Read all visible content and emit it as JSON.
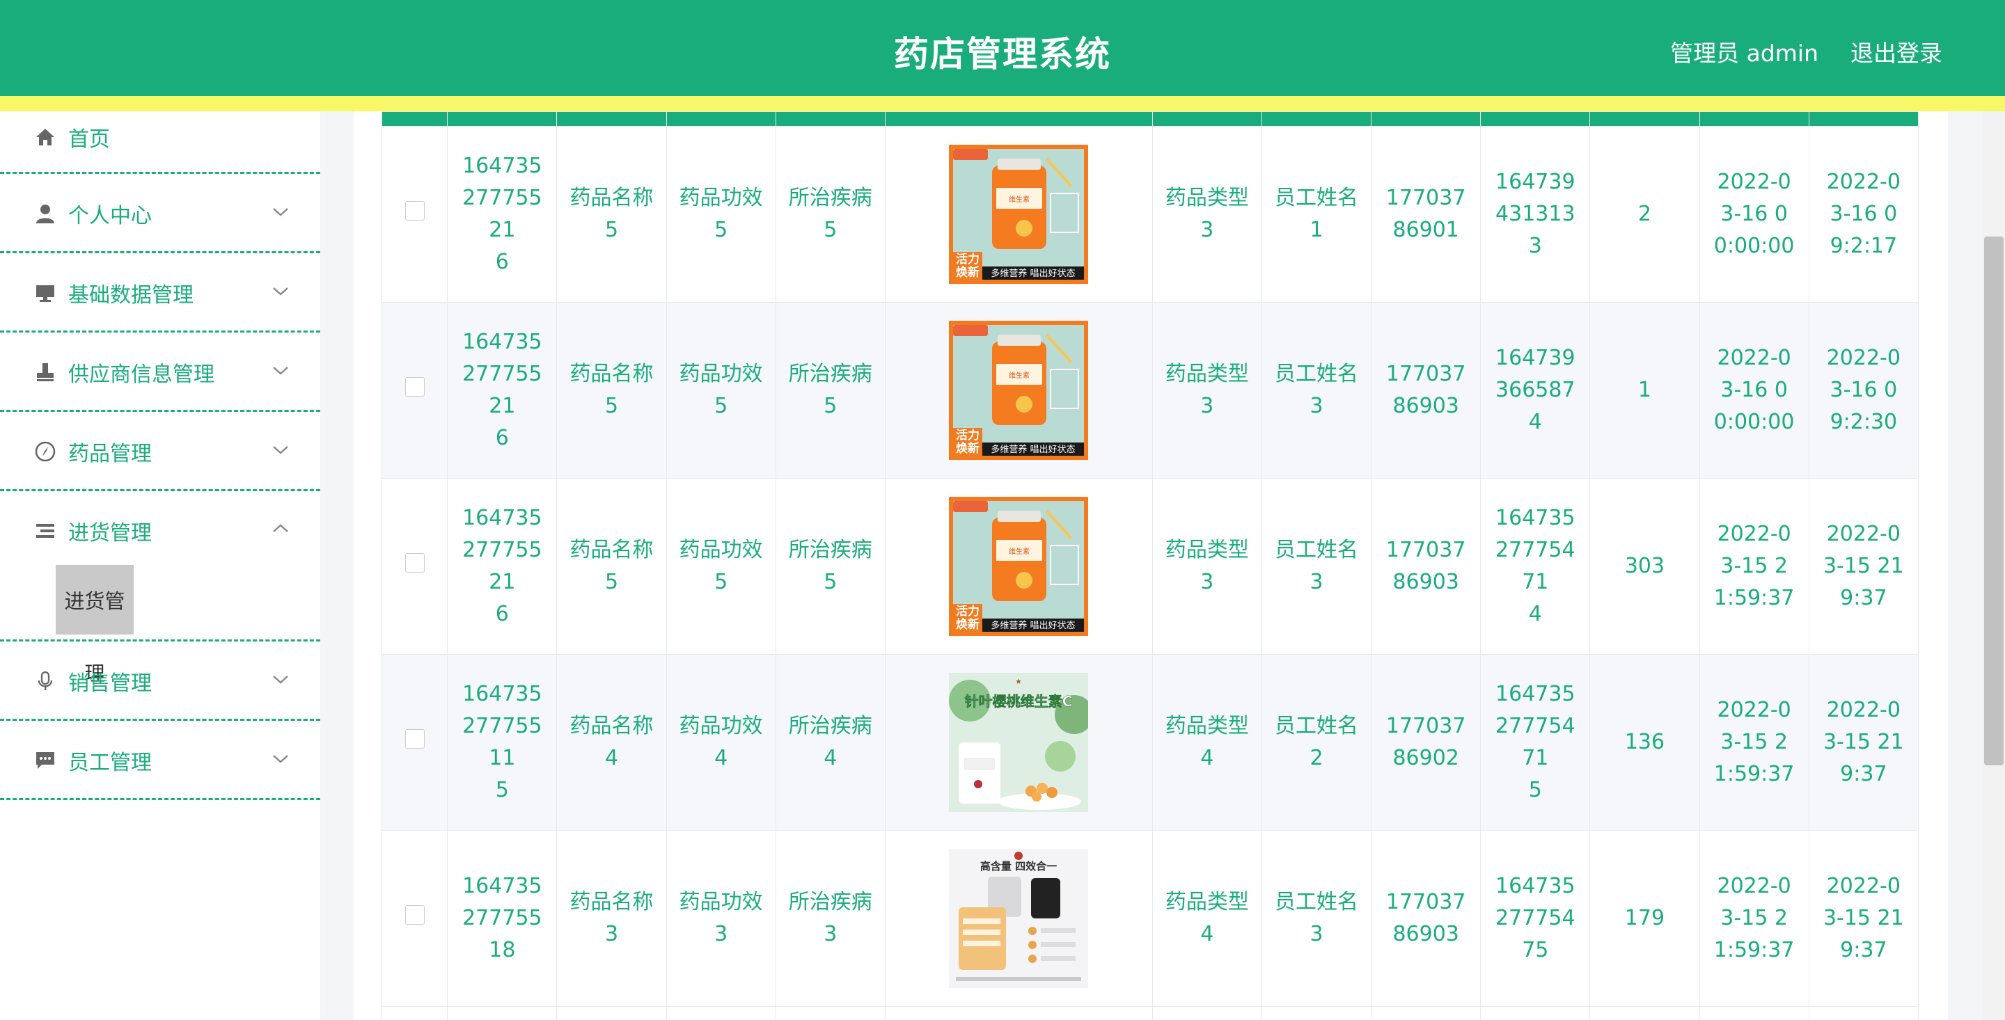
{
  "header": {
    "title": "药店管理系统",
    "user": "管理员 admin",
    "logout": "退出登录",
    "color": "#1aad7c",
    "stripe_color": "#f6f868"
  },
  "sidebar": {
    "items": [
      {
        "label": "首页",
        "icon": "home-icon"
      },
      {
        "label": "个人中心",
        "icon": "user-icon"
      },
      {
        "label": "基础数据管理",
        "icon": "monitor-icon"
      },
      {
        "label": "供应商信息管理",
        "icon": "stamp-icon"
      },
      {
        "label": "药品管理",
        "icon": "compass-icon"
      },
      {
        "label": "进货管理",
        "icon": "list-icon",
        "submenu": [
          "进货管理"
        ]
      },
      {
        "label": "销售管理",
        "icon": "microphone-icon"
      },
      {
        "label": "员工管理",
        "icon": "chat-icon"
      }
    ]
  },
  "table": {
    "rows": [
      {
        "id": "16473527775521\n6",
        "name": "药品名称\n5",
        "effect": "药品功效\n5",
        "disease": "所治疾病\n5",
        "image": "orange-supplement",
        "type": "药品类型\n3",
        "staff": "员工姓名\n1",
        "phone": "17703786901",
        "order": "1647394313133",
        "qty": "2",
        "date": "2022-03-16 00:00:00",
        "time": "2022-03-16 09:2:17"
      },
      {
        "id": "16473527775521\n6",
        "name": "药品名称\n5",
        "effect": "药品功效\n5",
        "disease": "所治疾病\n5",
        "image": "orange-supplement",
        "type": "药品类型\n3",
        "staff": "员工姓名\n3",
        "phone": "17703786903",
        "order": "1647393665874",
        "qty": "1",
        "date": "2022-03-16 00:00:00",
        "time": "2022-03-16 09:2:30"
      },
      {
        "id": "16473527775521\n6",
        "name": "药品名称\n5",
        "effect": "药品功效\n5",
        "disease": "所治疾病\n5",
        "image": "orange-supplement",
        "type": "药品类型\n3",
        "staff": "员工姓名\n3",
        "phone": "17703786903",
        "order": "16473527775471\n4",
        "qty": "303",
        "date": "2022-03-15 21:59:37",
        "time": "2022-03-15 219:37"
      },
      {
        "id": "16473527775511\n5",
        "name": "药品名称\n4",
        "effect": "药品功效\n4",
        "disease": "所治疾病\n4",
        "image": "vitamin-c",
        "type": "药品类型\n4",
        "staff": "员工姓名\n2",
        "phone": "17703786902",
        "order": "16473527775471\n5",
        "qty": "136",
        "date": "2022-03-15 21:59:37",
        "time": "2022-03-15 219:37"
      },
      {
        "id": "16473527775518",
        "name": "药品名称\n3",
        "effect": "药品功效\n3",
        "disease": "所治疾病\n3",
        "image": "calcium-poster",
        "type": "药品类型\n4",
        "staff": "员工姓名\n3",
        "phone": "17703786903",
        "order": "16473527775475",
        "qty": "179",
        "date": "2022-03-15 21:59:37",
        "time": "2022-03-15 219:37"
      }
    ]
  },
  "product_images": {
    "orange-supplement": {
      "badge": "活力\n焕新",
      "caption": "多维营养 唱出好状态",
      "jar_label": "维生素"
    },
    "vitamin-c": {
      "headline": "针叶樱桃维生素C"
    },
    "calcium-poster": {
      "headline": "高含量 四效合一"
    }
  }
}
